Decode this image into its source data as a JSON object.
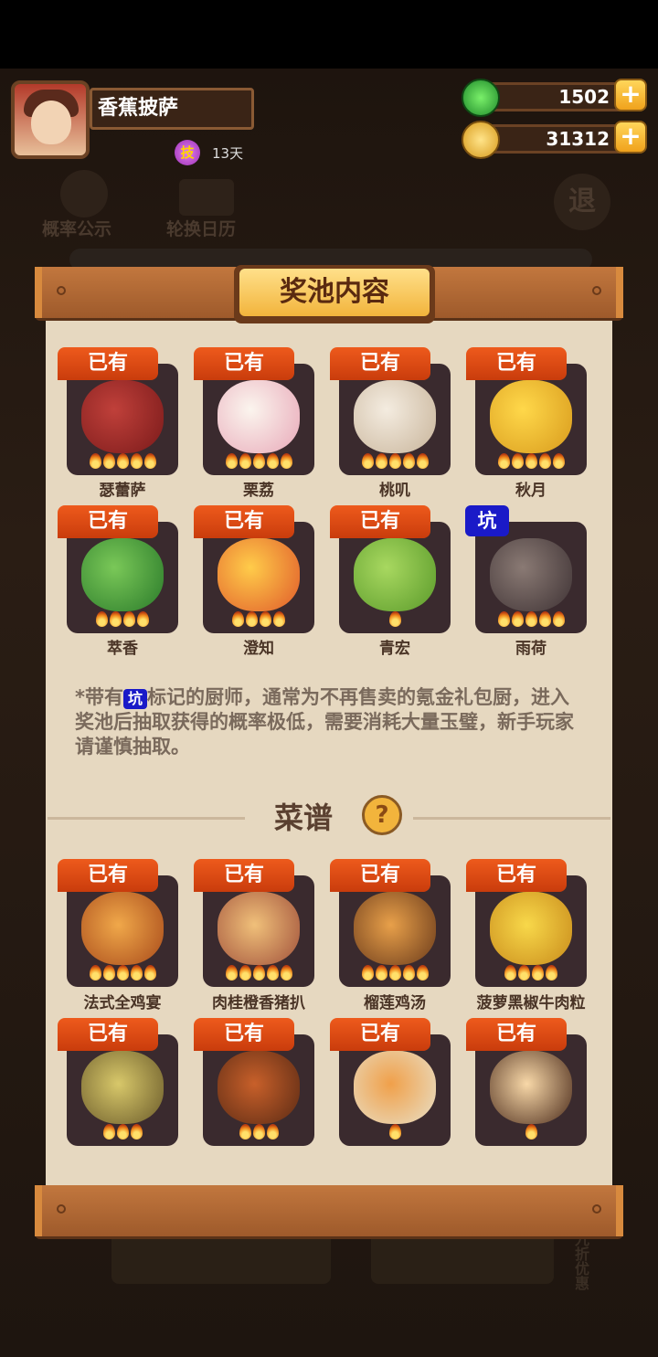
{
  "player": {
    "name": "香蕉披萨",
    "skill_badge": "技",
    "days": "13天"
  },
  "resources": {
    "jade": "1502",
    "coins": "31312",
    "plus": "+"
  },
  "background_nav": {
    "probability": "概率公示",
    "calendar": "轮换日历",
    "exit": "退",
    "discount": "九折优惠"
  },
  "panel": {
    "title": "奖池内容",
    "owned_label": "已有",
    "pit_label": "坑",
    "chefs": [
      {
        "name": "瑟蕾萨",
        "owned": true,
        "stars": 5
      },
      {
        "name": "栗荔",
        "owned": true,
        "stars": 5
      },
      {
        "name": "桃叽",
        "owned": true,
        "stars": 5
      },
      {
        "name": "秋月",
        "owned": true,
        "stars": 5
      },
      {
        "name": "萃香",
        "owned": true,
        "stars": 4
      },
      {
        "name": "澄知",
        "owned": true,
        "stars": 4
      },
      {
        "name": "青宏",
        "owned": true,
        "stars": 1
      },
      {
        "name": "雨荷",
        "owned": false,
        "pit": true,
        "stars": 5
      }
    ],
    "note_prefix": "*带有",
    "note_suffix": "标记的厨师，通常为不再售卖的氪金礼包厨，进入奖池后抽取获得的概率极低，需要消耗大量玉璧，新手玩家请谨慎抽取。",
    "recipes_title": "菜谱",
    "help": "?",
    "recipes": [
      {
        "name": "法式全鸡宴",
        "owned": true,
        "stars": 5
      },
      {
        "name": "肉桂橙香猪扒",
        "owned": true,
        "stars": 5
      },
      {
        "name": "榴莲鸡汤",
        "owned": true,
        "stars": 5
      },
      {
        "name": "菠萝黑椒牛肉粒",
        "owned": true,
        "stars": 4
      },
      {
        "name": "",
        "owned": true,
        "stars": 3
      },
      {
        "name": "",
        "owned": true,
        "stars": 3
      },
      {
        "name": "",
        "owned": true,
        "stars": 1
      },
      {
        "name": "",
        "owned": true,
        "stars": 1
      }
    ]
  },
  "colors": {
    "tag_orange": "#e0501a",
    "pit_blue": "#1a1ac8",
    "paper": "#e6d8c0",
    "board": "#b06a34"
  }
}
